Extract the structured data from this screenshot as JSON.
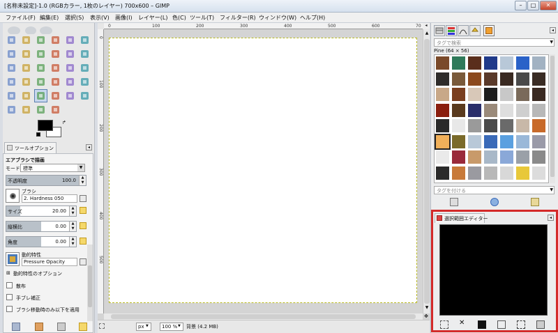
{
  "window": {
    "title": "[名称未設定]-1.0 (RGBカラー, 1枚のレイヤー) 700x600 – GIMP",
    "min_label": "–",
    "max_label": "□",
    "close_label": "✕"
  },
  "menu": [
    {
      "label": "ファイル(F)"
    },
    {
      "label": "編集(E)"
    },
    {
      "label": "選択(S)"
    },
    {
      "label": "表示(V)"
    },
    {
      "label": "画像(I)"
    },
    {
      "label": "レイヤー(L)"
    },
    {
      "label": "色(C)"
    },
    {
      "label": "ツール(T)"
    },
    {
      "label": "フィルター(R)"
    },
    {
      "label": "ウィンドウ(W)"
    },
    {
      "label": "ヘルプ(H)"
    }
  ],
  "toolbox": {
    "tools": [
      {
        "name": "rect-select"
      },
      {
        "name": "ellipse-select"
      },
      {
        "name": "free-select"
      },
      {
        "name": "fuzzy-select"
      },
      {
        "name": "color-select"
      },
      {
        "name": "scissors"
      },
      {
        "name": "foreground-select"
      },
      {
        "name": "paths"
      },
      {
        "name": "color-picker"
      },
      {
        "name": "zoom"
      },
      {
        "name": "measure"
      },
      {
        "name": "move"
      },
      {
        "name": "align"
      },
      {
        "name": "crop"
      },
      {
        "name": "rotate"
      },
      {
        "name": "scale"
      },
      {
        "name": "shear"
      },
      {
        "name": "perspective"
      },
      {
        "name": "flip"
      },
      {
        "name": "cage"
      },
      {
        "name": "text"
      },
      {
        "name": "bucket-fill"
      },
      {
        "name": "blend"
      },
      {
        "name": "pencil"
      },
      {
        "name": "paintbrush"
      },
      {
        "name": "eraser"
      },
      {
        "name": "airbrush"
      },
      {
        "name": "ink"
      },
      {
        "name": "clone"
      },
      {
        "name": "heal"
      },
      {
        "name": "perspective-clone"
      },
      {
        "name": "blur-sharpen"
      },
      {
        "name": "smudge"
      },
      {
        "name": "dodge-burn"
      }
    ],
    "fg_color": "#000000",
    "bg_color": "#ffffff"
  },
  "tool_options": {
    "tab_label": "ツールオプション",
    "tool_title": "エアブラシで描画",
    "mode_label": "モード:",
    "mode_value": "標準",
    "opacity_label": "不透明度",
    "opacity_value": "100.0",
    "opacity_fraction": 1.0,
    "brush_label": "ブラシ",
    "brush_value": "2. Hardness 050",
    "size_label": "サイズ",
    "size_value": "20.00",
    "size_fraction": 0.2,
    "aspect_label": "縦横比",
    "aspect_value": "0.00",
    "aspect_fraction": 0.5,
    "angle_label": "角度",
    "angle_value": "0.00",
    "angle_fraction": 0.5,
    "dynamics_label": "動的特性",
    "dynamics_value": "Pressure Opacity",
    "dynamics_options_label": "動的特性のオプション",
    "scatter_label": "散布",
    "jitter_label": "手ブレ補正",
    "apply_jitter_label": "ブラシ移動時のみ以下を適用"
  },
  "canvas": {
    "hruler_ticks": [
      "0",
      "100",
      "200",
      "300",
      "400",
      "500",
      "600",
      "70"
    ],
    "vruler_ticks": [
      "0",
      "100",
      "200",
      "300",
      "400",
      "500"
    ],
    "unit_value": "px",
    "zoom_value": "100 %",
    "status_text": "背景 (4.2 MB)"
  },
  "patterns": {
    "tag_placeholder": "タグで検索",
    "pattern_name": "Pine (64 × 56)",
    "tag_assign_placeholder": "タグを付ける",
    "swatches": [
      "#7a4a2a",
      "#2f7a5a",
      "#5a2e1c",
      "#203a8a",
      "#b8c8d8",
      "#2a62c8",
      "#a2b2c2",
      "#2e2c2a",
      "#7a5a3a",
      "#8c4a1e",
      "#5a3a2a",
      "#3a2a22",
      "#4a4a4a",
      "#3a2c24",
      "#c8a888",
      "#7a3e1e",
      "#d8c8b8",
      "#1e1e1e",
      "#c8c8c8",
      "#7a6a5a",
      "#3a2a22",
      "#8a1e0e",
      "#5a3a1e",
      "#2a2e6a",
      "#9a8a7a",
      "#dedede",
      "#cfcfcf",
      "#b8b8b8",
      "#2a2a2a",
      "#e8e8e8",
      "#9a9a9a",
      "#4a4a4a",
      "#6a6a6a",
      "#c8b8a8",
      "#c86a2a",
      "#f0b05a",
      "#7a6a2a",
      "#b8c8d8",
      "#3a6ab8",
      "#5aa0e0",
      "#9ab8d8",
      "#9a9aa8",
      "#eaeaea",
      "#9a2a3a",
      "#c89a6a",
      "#a8b8c8",
      "#8aa8d8",
      "#9aa0a8",
      "#8a8a8a",
      "#2a2a2a",
      "#c87a3a",
      "#9a9aa0",
      "#b8b8b8",
      "#d8d8d8",
      "#e8c83a",
      "#dcdcdc"
    ]
  },
  "selection_editor": {
    "tab_label": "選択範囲エディター",
    "highlight_color": "#d42a2a"
  }
}
